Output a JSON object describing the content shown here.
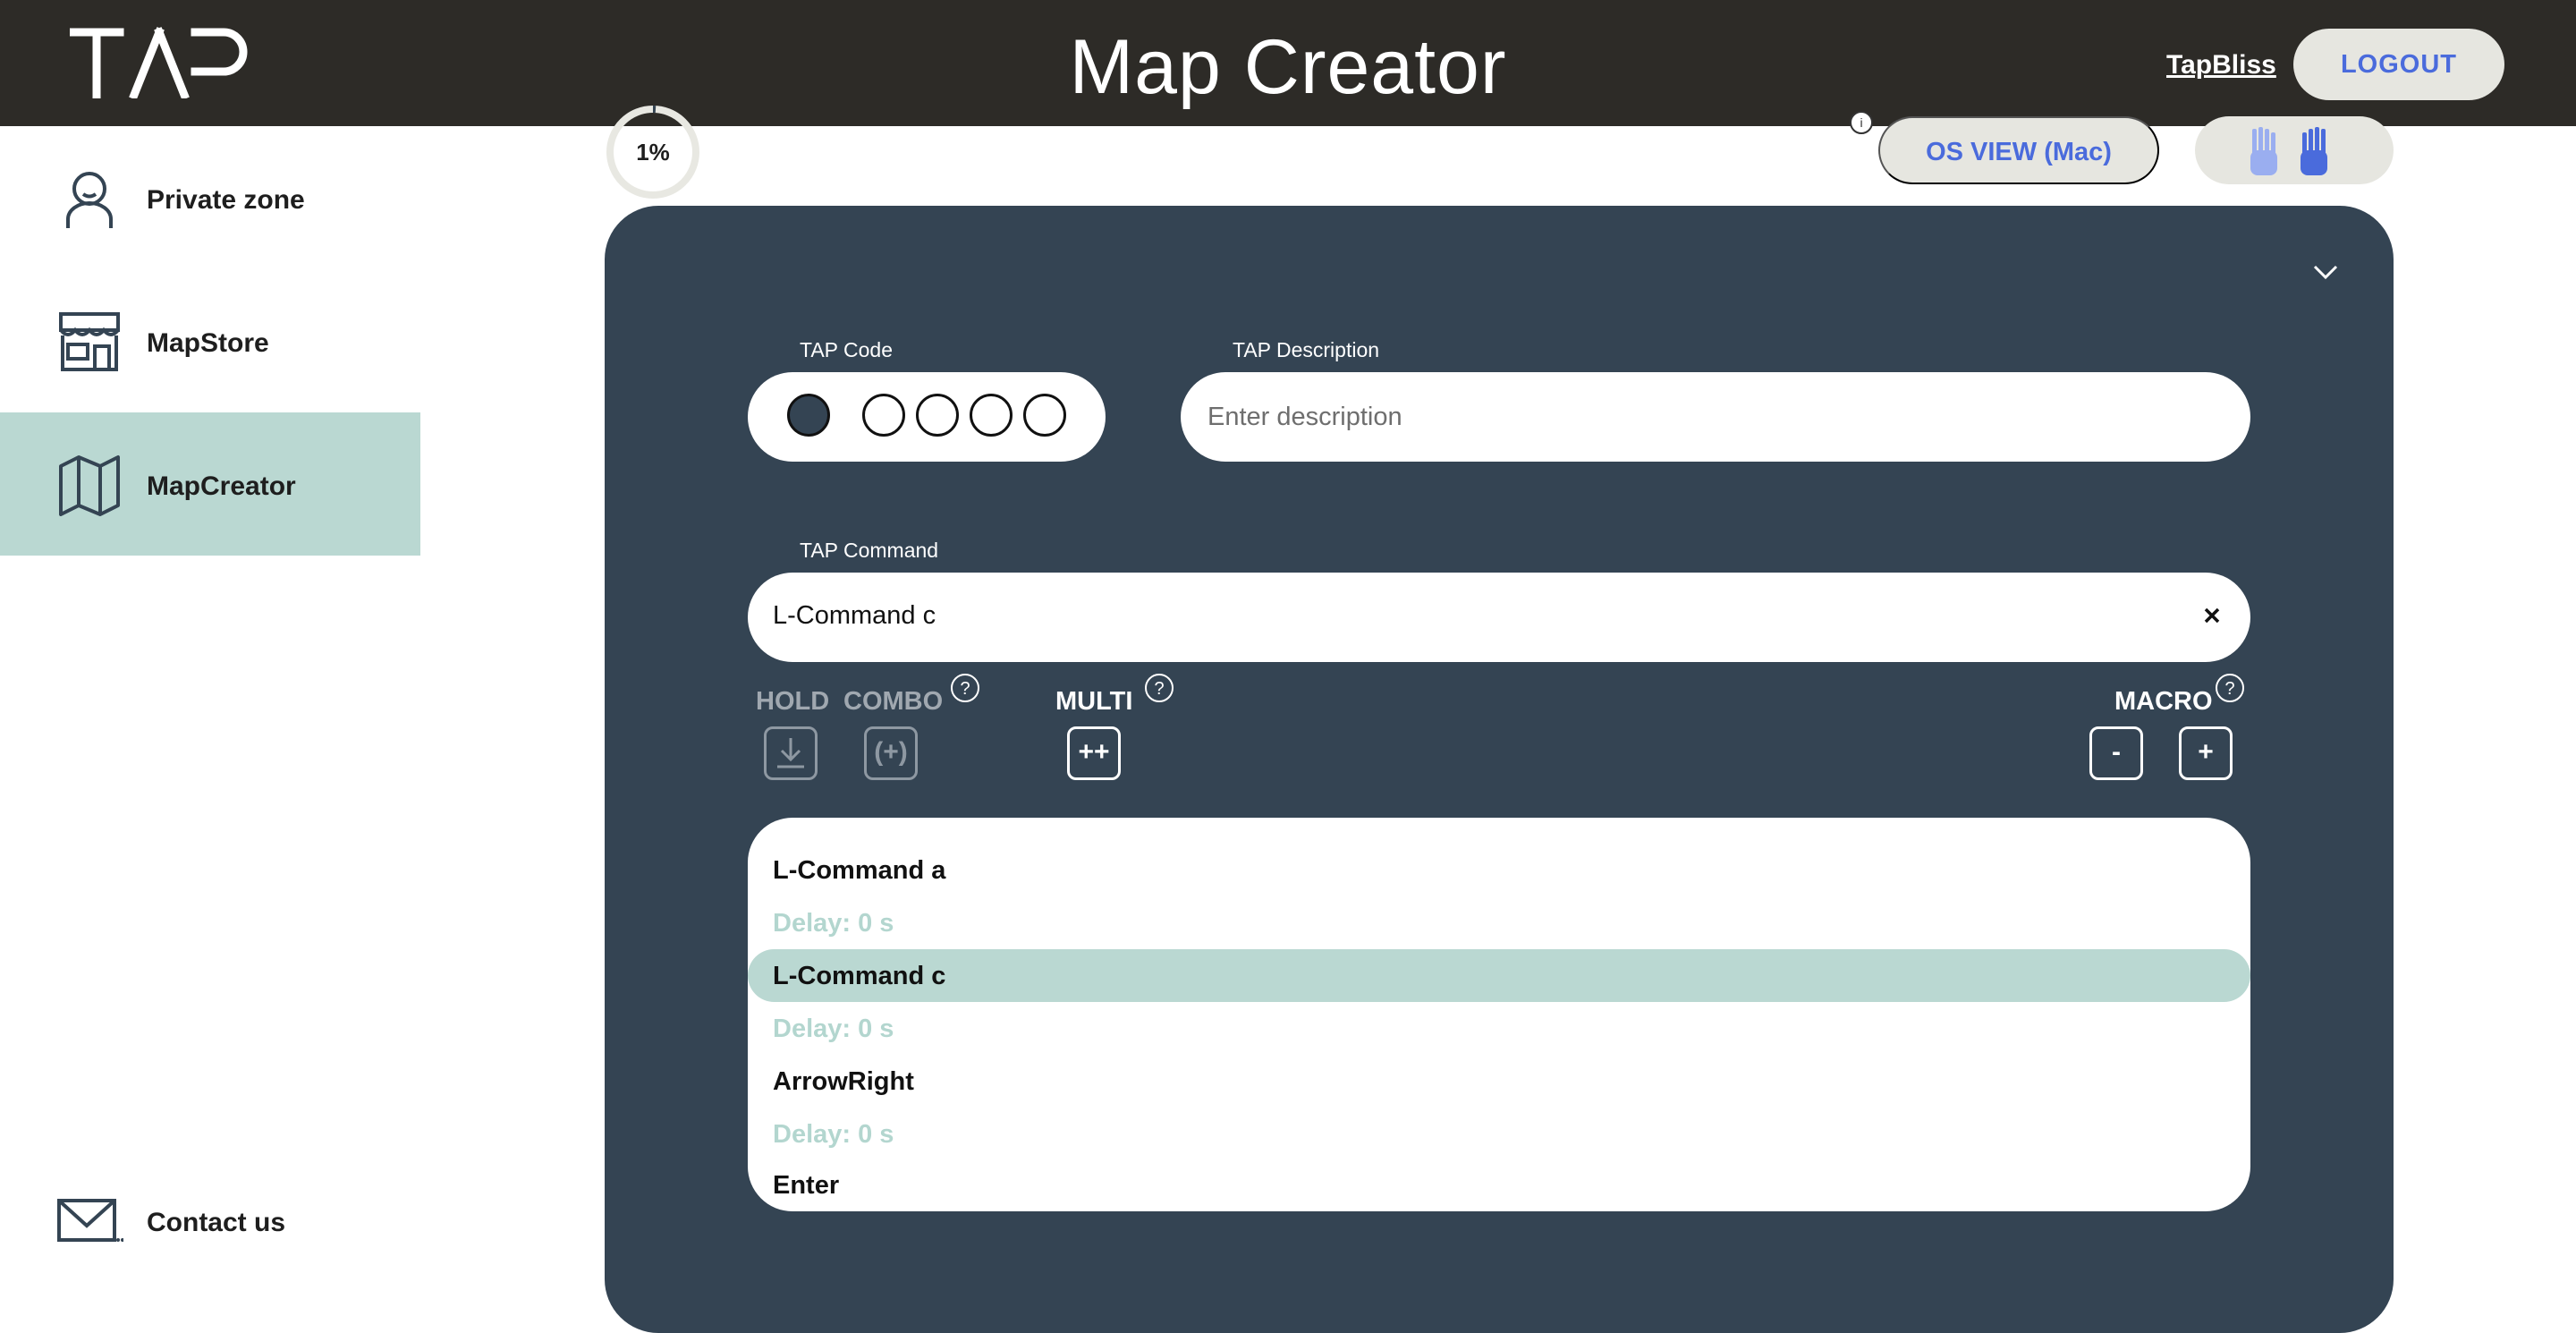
{
  "header": {
    "logo_text": "TAP",
    "title": "Map Creator",
    "user_name": "TapBliss",
    "logout_label": "LOGOUT"
  },
  "sidebar": {
    "items": [
      {
        "label": "Private zone",
        "icon": "user-icon"
      },
      {
        "label": "MapStore",
        "icon": "store-icon"
      },
      {
        "label": "MapCreator",
        "icon": "map-icon",
        "active": true
      }
    ],
    "contact": {
      "label": "Contact us",
      "icon": "mail-icon"
    }
  },
  "toolbar": {
    "progress": "1%",
    "os_view_label": "OS VIEW (Mac)",
    "hands_icon": "hands-icon"
  },
  "editor": {
    "tap_code_label": "TAP Code",
    "tap_code_dots": [
      true,
      false,
      false,
      false,
      false
    ],
    "tap_description_label": "TAP Description",
    "tap_description_placeholder": "Enter description",
    "tap_command_label": "TAP Command",
    "tap_command_value": "L-Command c",
    "options": {
      "hold_label": "HOLD",
      "combo_label": "COMBO",
      "multi_label": "MULTI",
      "macro_label": "MACRO",
      "combo_button": "(+)",
      "multi_button": "++",
      "macro_minus": "-",
      "macro_plus": "+"
    },
    "macro_steps": [
      {
        "text": "L-Command a",
        "type": "key"
      },
      {
        "text": "Delay: 0 s",
        "type": "delay"
      },
      {
        "text": "L-Command c",
        "type": "key",
        "selected": true
      },
      {
        "text": "Delay: 0 s",
        "type": "delay"
      },
      {
        "text": "ArrowRight",
        "type": "key"
      },
      {
        "text": "Delay: 0 s",
        "type": "delay"
      },
      {
        "text": "Enter",
        "type": "key"
      }
    ]
  },
  "colors": {
    "header_bg": "#2d2b27",
    "panel_bg": "#344453",
    "accent_teal": "#bad8d2",
    "button_text_blue": "#4a6bdc",
    "pill_bg": "#e6e6e0"
  }
}
